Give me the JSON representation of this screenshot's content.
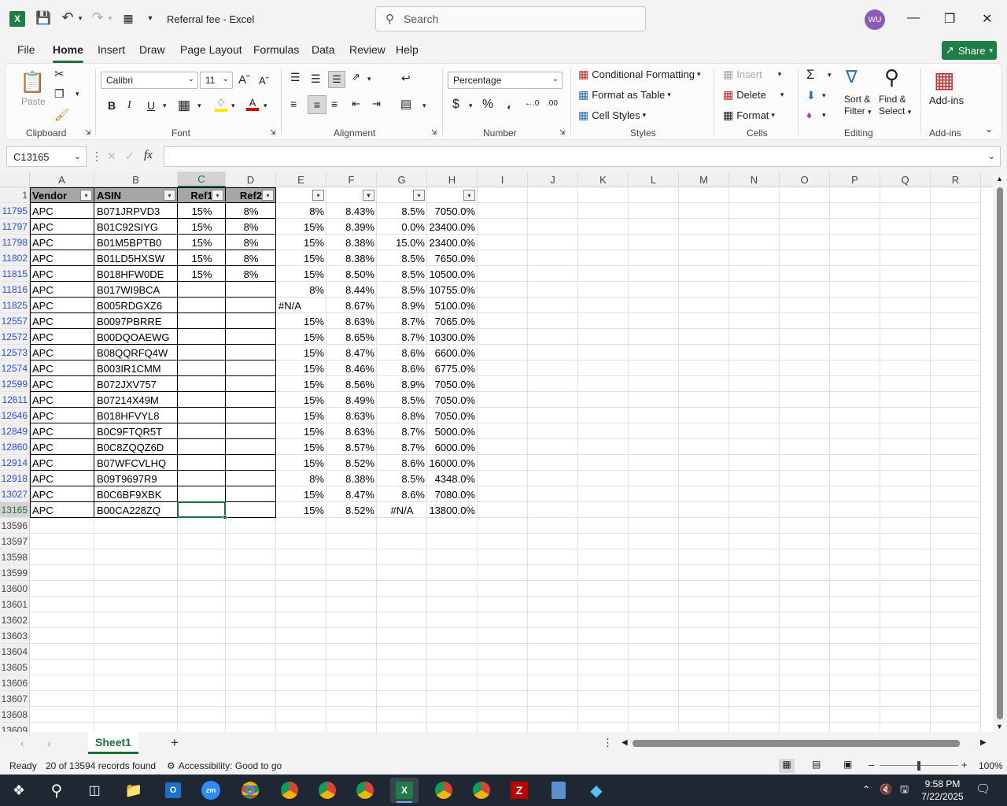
{
  "titlebar": {
    "doc_title": "Referral fee  -  Excel",
    "search_placeholder": "Search",
    "avatar_initials": "WU"
  },
  "menu": [
    "File",
    "Home",
    "Insert",
    "Draw",
    "Page Layout",
    "Formulas",
    "Data",
    "Review",
    "Help"
  ],
  "share_label": "Share",
  "ribbon": {
    "clipboard": {
      "paste": "Paste",
      "label": "Clipboard"
    },
    "font": {
      "name": "Calibri",
      "size": "11",
      "label": "Font"
    },
    "alignment": {
      "label": "Alignment"
    },
    "number": {
      "format": "Percentage",
      "label": "Number"
    },
    "styles": {
      "cond": "Conditional Formatting",
      "table": "Format as Table",
      "cell": "Cell Styles",
      "label": "Styles"
    },
    "cells": {
      "insert": "Insert",
      "delete": "Delete",
      "format": "Format",
      "label": "Cells"
    },
    "editing": {
      "sort": "Sort &",
      "filter": "Filter",
      "find": "Find &",
      "select": "Select",
      "label": "Editing"
    },
    "addins": {
      "btn": "Add-ins",
      "label": "Add-ins"
    }
  },
  "namebox": "C13165",
  "columns": [
    "A",
    "B",
    "C",
    "D",
    "E",
    "F",
    "G",
    "H",
    "I",
    "J",
    "K",
    "L",
    "M",
    "N",
    "O",
    "P",
    "Q",
    "R"
  ],
  "header_row": {
    "num": "1",
    "vendor": "Vendor",
    "asin": "ASIN",
    "ref1": "Ref1",
    "ref2": "Ref2"
  },
  "rows": [
    {
      "n": "11795",
      "a": "APC",
      "b": "B071JRPVD3",
      "c": "15%",
      "d": "8%",
      "e": "8%",
      "f": "8.43%",
      "g": "8.5%",
      "h": "7050.0%"
    },
    {
      "n": "11797",
      "a": "APC",
      "b": "B01C92SIYG",
      "c": "15%",
      "d": "8%",
      "e": "15%",
      "f": "8.39%",
      "g": "0.0%",
      "h": "23400.0%"
    },
    {
      "n": "11798",
      "a": "APC",
      "b": "B01M5BPTB0",
      "c": "15%",
      "d": "8%",
      "e": "15%",
      "f": "8.38%",
      "g": "15.0%",
      "h": "23400.0%"
    },
    {
      "n": "11802",
      "a": "APC",
      "b": "B01LD5HXSW",
      "c": "15%",
      "d": "8%",
      "e": "15%",
      "f": "8.38%",
      "g": "8.5%",
      "h": "7650.0%"
    },
    {
      "n": "11815",
      "a": "APC",
      "b": "B018HFW0DE",
      "c": "15%",
      "d": "8%",
      "e": "15%",
      "f": "8.50%",
      "g": "8.5%",
      "h": "10500.0%"
    },
    {
      "n": "11816",
      "a": "APC",
      "b": "B017WI9BCA",
      "c": "",
      "d": "",
      "e": "8%",
      "f": "8.44%",
      "g": "8.5%",
      "h": "10755.0%"
    },
    {
      "n": "11825",
      "a": "APC",
      "b": "B005RDGXZ6",
      "c": "",
      "d": "",
      "e": "#N/A",
      "f": "8.67%",
      "g": "8.9%",
      "h": "5100.0%"
    },
    {
      "n": "12557",
      "a": "APC",
      "b": "B0097PBRRE",
      "c": "",
      "d": "",
      "e": "15%",
      "f": "8.63%",
      "g": "8.7%",
      "h": "7065.0%"
    },
    {
      "n": "12572",
      "a": "APC",
      "b": "B00DQOAEWG",
      "c": "",
      "d": "",
      "e": "15%",
      "f": "8.65%",
      "g": "8.7%",
      "h": "10300.0%"
    },
    {
      "n": "12573",
      "a": "APC",
      "b": "B08QQRFQ4W",
      "c": "",
      "d": "",
      "e": "15%",
      "f": "8.47%",
      "g": "8.6%",
      "h": "6600.0%"
    },
    {
      "n": "12574",
      "a": "APC",
      "b": "B003IR1CMM",
      "c": "",
      "d": "",
      "e": "15%",
      "f": "8.46%",
      "g": "8.6%",
      "h": "6775.0%"
    },
    {
      "n": "12599",
      "a": "APC",
      "b": "B072JXV757",
      "c": "",
      "d": "",
      "e": "15%",
      "f": "8.56%",
      "g": "8.9%",
      "h": "7050.0%"
    },
    {
      "n": "12611",
      "a": "APC",
      "b": "B07214X49M",
      "c": "",
      "d": "",
      "e": "15%",
      "f": "8.49%",
      "g": "8.5%",
      "h": "7050.0%"
    },
    {
      "n": "12646",
      "a": "APC",
      "b": "B018HFVYL8",
      "c": "",
      "d": "",
      "e": "15%",
      "f": "8.63%",
      "g": "8.8%",
      "h": "7050.0%"
    },
    {
      "n": "12849",
      "a": "APC",
      "b": "B0C9FTQR5T",
      "c": "",
      "d": "",
      "e": "15%",
      "f": "8.63%",
      "g": "8.7%",
      "h": "5000.0%"
    },
    {
      "n": "12860",
      "a": "APC",
      "b": "B0C8ZQQZ6D",
      "c": "",
      "d": "",
      "e": "15%",
      "f": "8.57%",
      "g": "8.7%",
      "h": "6000.0%"
    },
    {
      "n": "12914",
      "a": "APC",
      "b": "B07WFCVLHQ",
      "c": "",
      "d": "",
      "e": "15%",
      "f": "8.52%",
      "g": "8.6%",
      "h": "16000.0%"
    },
    {
      "n": "12918",
      "a": "APC",
      "b": "B09T9697R9",
      "c": "",
      "d": "",
      "e": "8%",
      "f": "8.38%",
      "g": "8.5%",
      "h": "4348.0%"
    },
    {
      "n": "13027",
      "a": "APC",
      "b": "B0C6BF9XBK",
      "c": "",
      "d": "",
      "e": "15%",
      "f": "8.47%",
      "g": "8.6%",
      "h": "7080.0%"
    },
    {
      "n": "13165",
      "a": "APC",
      "b": "B00CA228ZQ",
      "c": "",
      "d": "",
      "e": "15%",
      "f": "8.52%",
      "g": "#N/A",
      "h": "13800.0%"
    }
  ],
  "empty_rows": [
    "13596",
    "13597",
    "13598",
    "13599",
    "13600",
    "13601",
    "13602",
    "13603",
    "13604",
    "13605",
    "13606",
    "13607",
    "13608",
    "13609"
  ],
  "sheet_tab": "Sheet1",
  "status": {
    "ready": "Ready",
    "records": "20 of 13594 records found",
    "accessibility": "Accessibility: Good to go",
    "zoom": "100%"
  },
  "clock": {
    "time": "9:58 PM",
    "date": "7/22/2025"
  }
}
